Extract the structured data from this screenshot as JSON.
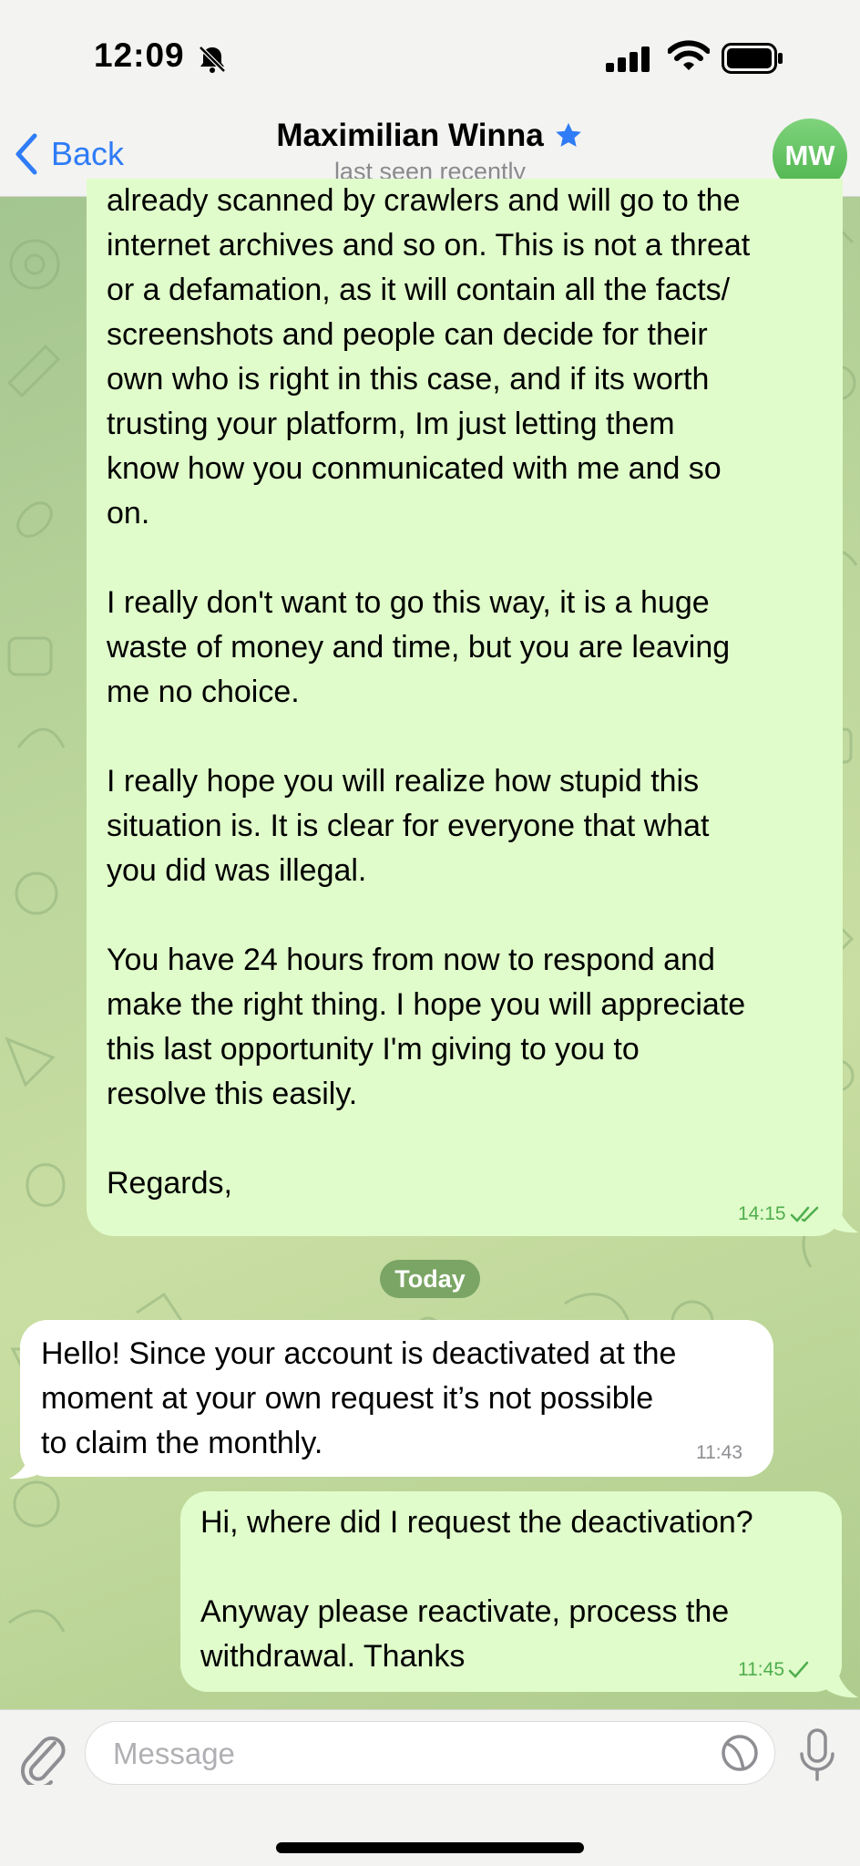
{
  "status": {
    "time": "12:09"
  },
  "header": {
    "back_label": "Back",
    "contact_name": "Maximilian Winna",
    "last_seen": "last seen recently",
    "avatar_initials": "MW"
  },
  "messages": [
    {
      "direction": "out",
      "text": "already scanned by crawlers and will go to the\ninternet archives and so on. This is not a threat\nor a defamation, as it will contain all the facts/\nscreenshots and people can decide for their\nown who is right in this case, and if its worth\ntrusting your platform, Im just letting them\nknow how you conmunicated with me and so\non.\n\nI really don't want to go this way, it is a huge\nwaste of money and time, but you are leaving\nme no choice.\n\nI really hope you will realize how stupid this\nsituation is. It is clear for everyone that what\nyou did was illegal.\n\nYou have 24 hours from now to respond and\nmake the right thing. I hope you will appreciate\nthis last opportunity I'm giving to you to\nresolve this easily.\n\nRegards,",
      "time": "14:15",
      "status": "read"
    },
    {
      "direction": "in",
      "text": "Hello! Since your account is deactivated at the\nmoment at your own request it’s not possible\nto claim the monthly.",
      "time": "11:43"
    },
    {
      "direction": "out",
      "text": "Hi, where did I request the deactivation?\n\nAnyway please reactivate, process the\nwithdrawal. Thanks",
      "time": "11:45",
      "status": "sent"
    }
  ],
  "date_separator": "Today",
  "composer": {
    "placeholder": "Message"
  },
  "colors": {
    "accent": "#2f7cf6",
    "outgoing_bubble": "#e0fcca",
    "incoming_bubble": "#ffffff",
    "check_marks": "#4fae4e",
    "avatar": "#5cc05a",
    "date_pill": "#7aa564"
  }
}
